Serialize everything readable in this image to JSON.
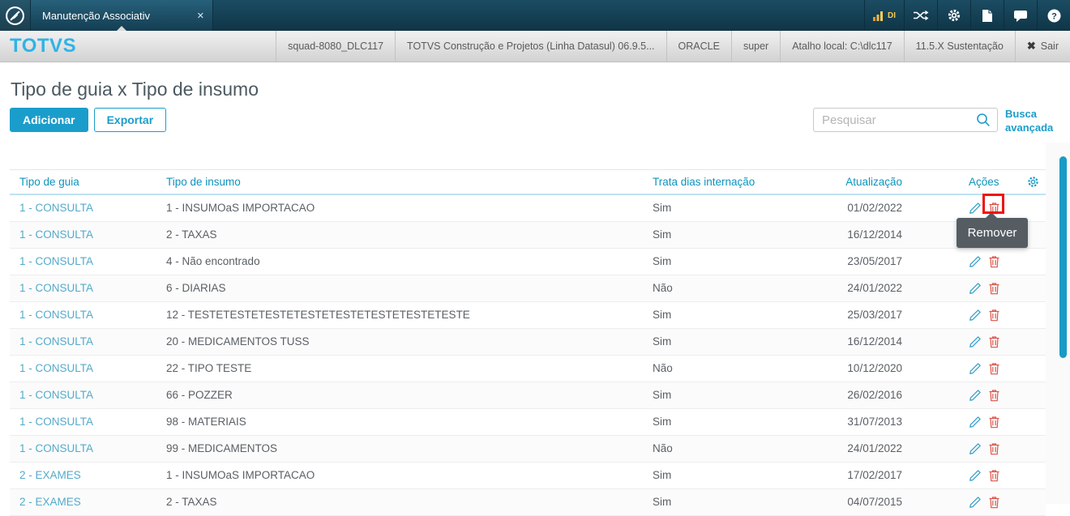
{
  "titlebar": {
    "tab_title": "Manutenção Associativ",
    "tab_close": "✕",
    "di_badge": "DI"
  },
  "header": {
    "brand": "TOTVS",
    "env_items": [
      "squad-8080_DLC117",
      "TOTVS Construção e Projetos (Linha Datasul) 06.9.5...",
      "ORACLE",
      "super",
      "Atalho local: C:\\dlc117",
      "11.5.X Sustentação"
    ],
    "exit_icon": "✖",
    "exit_label": "Sair"
  },
  "page": {
    "title": "Tipo de guia x Tipo de insumo",
    "buttons": {
      "add": "Adicionar",
      "export": "Exportar"
    },
    "search": {
      "placeholder": "Pesquisar"
    },
    "advanced_search": "Busca avançada"
  },
  "table": {
    "columns": {
      "guia": "Tipo de guia",
      "insumo": "Tipo de insumo",
      "trata": "Trata dias internação",
      "atualizacao": "Atualização",
      "acoes": "Ações"
    },
    "rows": [
      {
        "guia": "1 - CONSULTA",
        "insumo": "1 - INSUMOaS IMPORTACAO",
        "trata": "Sim",
        "atualizacao": "01/02/2022"
      },
      {
        "guia": "1 - CONSULTA",
        "insumo": "2 - TAXAS",
        "trata": "Sim",
        "atualizacao": "16/12/2014"
      },
      {
        "guia": "1 - CONSULTA",
        "insumo": "4 - Não encontrado",
        "trata": "Sim",
        "atualizacao": "23/05/2017"
      },
      {
        "guia": "1 - CONSULTA",
        "insumo": "6 - DIARIAS",
        "trata": "Não",
        "atualizacao": "24/01/2022"
      },
      {
        "guia": "1 - CONSULTA",
        "insumo": "12 - TESTETESTETESTETESTETESTETESTETESTETESTE",
        "trata": "Sim",
        "atualizacao": "25/03/2017"
      },
      {
        "guia": "1 - CONSULTA",
        "insumo": "20 - MEDICAMENTOS TUSS",
        "trata": "Sim",
        "atualizacao": "16/12/2014"
      },
      {
        "guia": "1 - CONSULTA",
        "insumo": "22 - TIPO TESTE",
        "trata": "Não",
        "atualizacao": "10/12/2020"
      },
      {
        "guia": "1 - CONSULTA",
        "insumo": "66 - POZZER",
        "trata": "Sim",
        "atualizacao": "26/02/2016"
      },
      {
        "guia": "1 - CONSULTA",
        "insumo": "98 - MATERIAIS",
        "trata": "Sim",
        "atualizacao": "31/07/2013"
      },
      {
        "guia": "1 - CONSULTA",
        "insumo": "99 - MEDICAMENTOS",
        "trata": "Não",
        "atualizacao": "24/01/2022"
      },
      {
        "guia": "2 - EXAMES",
        "insumo": "1 - INSUMOaS IMPORTACAO",
        "trata": "Sim",
        "atualizacao": "17/02/2017"
      },
      {
        "guia": "2 - EXAMES",
        "insumo": "2 - TAXAS",
        "trata": "Sim",
        "atualizacao": "04/07/2015"
      }
    ]
  },
  "tooltip": {
    "label": "Remover"
  },
  "colors": {
    "accent": "#1b9dcb",
    "brand_blue": "#2fb3e8",
    "danger": "#dd5347",
    "highlight_red": "#f01010",
    "tooltip_bg": "#555d63",
    "topbar": "#123c4f"
  }
}
